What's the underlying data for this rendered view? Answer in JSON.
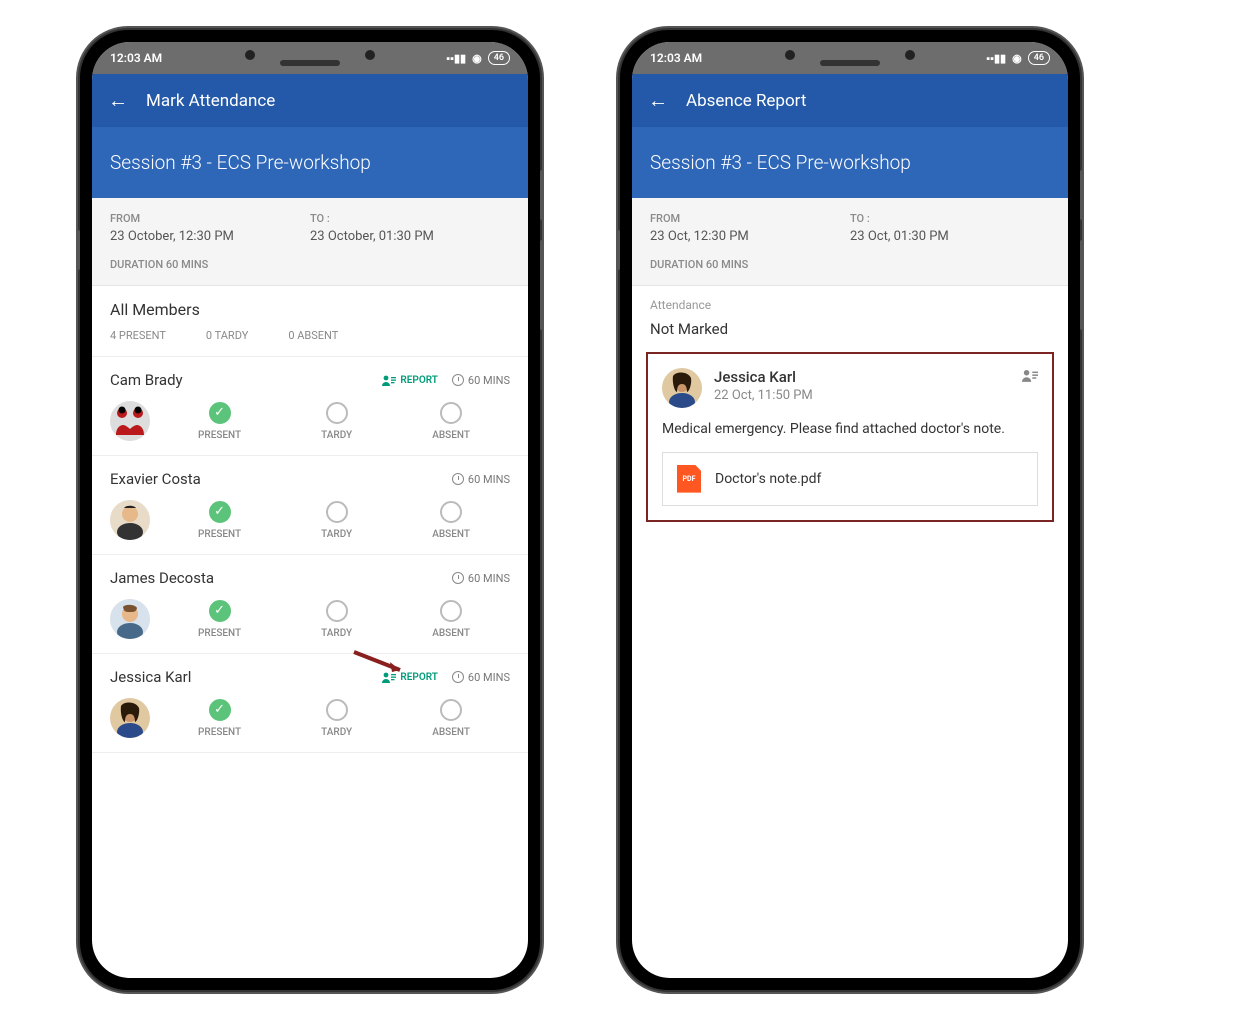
{
  "statusbar": {
    "time": "12:03 AM",
    "battery": "46"
  },
  "phone1": {
    "appbar_title": "Mark Attendance",
    "session_title": "Session #3 - ECS Pre-workshop",
    "info": {
      "from_label": "FROM",
      "from_value": "23 October, 12:30 PM",
      "to_label": "TO :",
      "to_value": "23 October, 01:30 PM",
      "duration": "DURATION 60 MINS"
    },
    "section_title": "All Members",
    "stats": {
      "present": "4 PRESENT",
      "tardy": "0 TARDY",
      "absent": "0 ABSENT"
    },
    "opt_present": "PRESENT",
    "opt_tardy": "TARDY",
    "opt_absent": "ABSENT",
    "report_label": "REPORT",
    "mins_label": "60 MINS",
    "members": [
      {
        "name": "Cam Brady",
        "has_report": true
      },
      {
        "name": "Exavier Costa",
        "has_report": false
      },
      {
        "name": "James Decosta",
        "has_report": false
      },
      {
        "name": "Jessica Karl",
        "has_report": true
      }
    ]
  },
  "phone2": {
    "appbar_title": "Absence Report",
    "session_title": "Session #3 - ECS Pre-workshop",
    "info": {
      "from_label": "FROM",
      "from_value": "23 Oct, 12:30 PM",
      "to_label": "TO :",
      "to_value": "23 Oct, 01:30 PM",
      "duration": "DURATION 60 MINS"
    },
    "attendance_label": "Attendance",
    "notmarked": "Not Marked",
    "report": {
      "name": "Jessica Karl",
      "time": "22 Oct, 11:50 PM",
      "message": "Medical emergency. Please find attached doctor's note.",
      "attachment": "Doctor's note.pdf",
      "pdf_badge": "PDF"
    }
  }
}
